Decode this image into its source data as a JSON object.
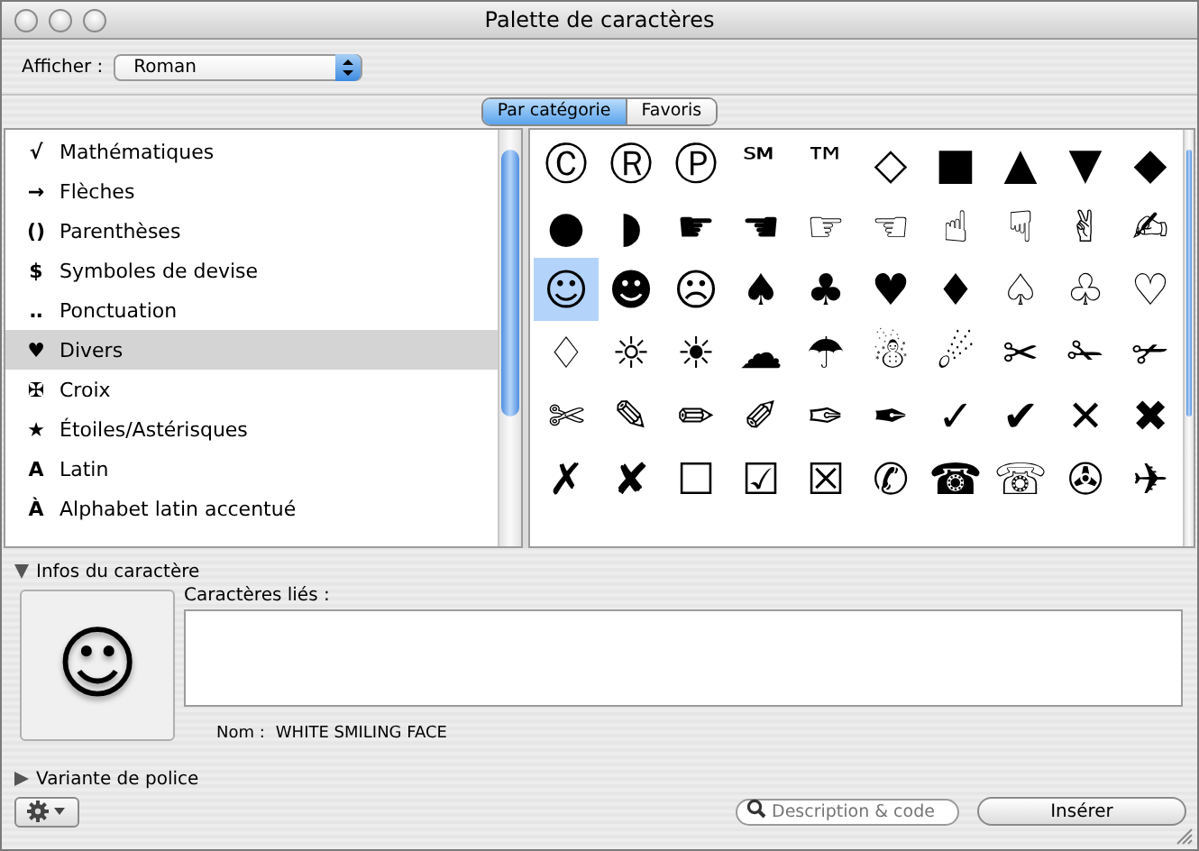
{
  "window": {
    "title": "Palette de caractères"
  },
  "toolbar": {
    "label": "Afficher :",
    "popup": "Roman"
  },
  "view_tabs": [
    {
      "label": "Par catégorie",
      "selected": true
    },
    {
      "label": "Favoris",
      "selected": false
    }
  ],
  "categories": [
    {
      "icon": "√",
      "label": "Mathématiques",
      "selected": false
    },
    {
      "icon": "→",
      "label": "Flèches",
      "selected": false
    },
    {
      "icon": "()",
      "label": "Parenthèses",
      "selected": false
    },
    {
      "icon": "$",
      "label": "Symboles de devise",
      "selected": false
    },
    {
      "icon": "‥",
      "label": "Ponctuation",
      "selected": false
    },
    {
      "icon": "♥",
      "label": "Divers",
      "selected": true
    },
    {
      "icon": "✠",
      "label": "Croix",
      "selected": false
    },
    {
      "icon": "★",
      "label": "Étoiles/Astérisques",
      "selected": false
    },
    {
      "icon": "A",
      "label": "Latin",
      "selected": false
    },
    {
      "icon": "À",
      "label": "Alphabet latin accentué",
      "selected": false
    }
  ],
  "character_rows": [
    [
      {
        "glyph": "Ⓒ",
        "selected": false
      },
      {
        "glyph": "Ⓡ",
        "selected": false
      },
      {
        "glyph": "Ⓟ",
        "selected": false
      },
      {
        "glyph": "℠",
        "selected": false
      },
      {
        "glyph": "™",
        "selected": false
      },
      {
        "glyph": "◇",
        "selected": false
      },
      {
        "glyph": "■",
        "selected": false
      },
      {
        "glyph": "▲",
        "selected": false
      },
      {
        "glyph": "▼",
        "selected": false
      },
      {
        "glyph": "◆",
        "selected": false
      }
    ],
    [
      {
        "glyph": "●",
        "selected": false
      },
      {
        "glyph": "◗",
        "selected": false
      },
      {
        "glyph": "☛",
        "selected": false
      },
      {
        "glyph": "☚",
        "selected": false
      },
      {
        "glyph": "☞",
        "selected": false
      },
      {
        "glyph": "☜",
        "selected": false
      },
      {
        "glyph": "☝",
        "selected": false
      },
      {
        "glyph": "☟",
        "selected": false
      },
      {
        "glyph": "✌",
        "selected": false
      },
      {
        "glyph": "✍",
        "selected": false
      }
    ],
    [
      {
        "glyph": "☺",
        "selected": true
      },
      {
        "glyph": "☻",
        "selected": false
      },
      {
        "glyph": "☹",
        "selected": false
      },
      {
        "glyph": "♠",
        "selected": false
      },
      {
        "glyph": "♣",
        "selected": false
      },
      {
        "glyph": "♥",
        "selected": false
      },
      {
        "glyph": "♦",
        "selected": false
      },
      {
        "glyph": "♤",
        "selected": false
      },
      {
        "glyph": "♧",
        "selected": false
      },
      {
        "glyph": "♡",
        "selected": false
      }
    ],
    [
      {
        "glyph": "♢",
        "selected": false
      },
      {
        "glyph": "☼",
        "selected": false
      },
      {
        "glyph": "☀",
        "selected": false
      },
      {
        "glyph": "☁",
        "selected": false
      },
      {
        "glyph": "☂",
        "selected": false
      },
      {
        "glyph": "☃",
        "selected": false
      },
      {
        "glyph": "☄",
        "selected": false
      },
      {
        "glyph": "✂",
        "selected": false
      },
      {
        "glyph": "✁",
        "selected": false
      },
      {
        "glyph": "✃",
        "selected": false
      }
    ],
    [
      {
        "glyph": "✄",
        "selected": false
      },
      {
        "glyph": "✎",
        "selected": false
      },
      {
        "glyph": "✏",
        "selected": false
      },
      {
        "glyph": "✐",
        "selected": false
      },
      {
        "glyph": "✑",
        "selected": false
      },
      {
        "glyph": "✒",
        "selected": false
      },
      {
        "glyph": "✓",
        "selected": false
      },
      {
        "glyph": "✔",
        "selected": false
      },
      {
        "glyph": "✕",
        "selected": false
      },
      {
        "glyph": "✖",
        "selected": false
      }
    ],
    [
      {
        "glyph": "✗",
        "selected": false
      },
      {
        "glyph": "✘",
        "selected": false
      },
      {
        "glyph": "☐",
        "selected": false
      },
      {
        "glyph": "☑",
        "selected": false
      },
      {
        "glyph": "☒",
        "selected": false
      },
      {
        "glyph": "✆",
        "selected": false
      },
      {
        "glyph": "☎",
        "selected": false
      },
      {
        "glyph": "☏",
        "selected": false
      },
      {
        "glyph": "✇",
        "selected": false
      },
      {
        "glyph": "✈",
        "selected": false
      }
    ]
  ],
  "character_info": {
    "title": "Infos du caractère",
    "expanded": true,
    "preview": "☺",
    "related_label": "Caractères liés :",
    "name_label": "Nom :",
    "name": "WHITE SMILING FACE"
  },
  "font_variation": {
    "title": "Variante de police",
    "expanded": false
  },
  "search": {
    "placeholder": "Description & code"
  },
  "insert_button": "Insérer"
}
